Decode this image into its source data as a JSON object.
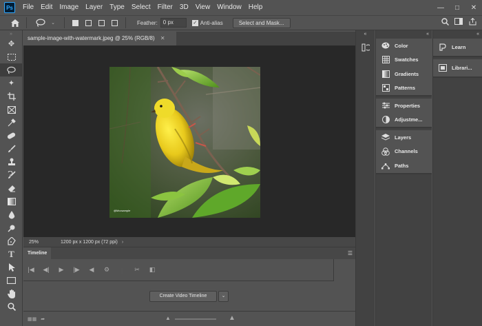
{
  "app": {
    "logo": "Ps",
    "menu": [
      "File",
      "Edit",
      "Image",
      "Layer",
      "Type",
      "Select",
      "Filter",
      "3D",
      "View",
      "Window",
      "Help"
    ],
    "window_controls": [
      "minimize-icon",
      "maximize-icon",
      "close-icon"
    ]
  },
  "options_bar": {
    "feather_label": "Feather:",
    "feather_value": "0 px",
    "anti_alias_label": "Anti-alias",
    "select_mask_label": "Select and Mask...",
    "icons": [
      "home-icon",
      "lasso-icon",
      "new-selection-icon",
      "add-selection-icon",
      "subtract-selection-icon",
      "intersect-selection-icon",
      "search-icon",
      "workspace-icon",
      "share-icon"
    ]
  },
  "tools": [
    "move-icon",
    "marquee-icon",
    "lasso-icon",
    "magic-wand-icon",
    "crop-icon",
    "frame-icon",
    "eyedropper-icon",
    "healing-brush-icon",
    "brush-icon",
    "clone-stamp-icon",
    "history-brush-icon",
    "eraser-icon",
    "gradient-icon",
    "blur-icon",
    "dodge-icon",
    "pen-icon",
    "type-icon",
    "path-selection-icon",
    "rectangle-icon",
    "hand-icon",
    "zoom-icon"
  ],
  "document": {
    "tab_title": "sample-image-with-watermark.jpeg @ 25% (RGB/8)",
    "watermark": "@Mccsample"
  },
  "status": {
    "zoom": "25%",
    "dimensions": "1200 px x 1200 px (72 ppi)",
    "arrow": "›"
  },
  "timeline": {
    "title": "Timeline",
    "create_button": "Create Video Timeline"
  },
  "panels_col1": {
    "group1": [
      {
        "label": "Color",
        "icon": "color-palette-icon"
      },
      {
        "label": "Swatches",
        "icon": "swatches-icon"
      },
      {
        "label": "Gradients",
        "icon": "gradients-icon"
      },
      {
        "label": "Patterns",
        "icon": "patterns-icon"
      }
    ],
    "group2": [
      {
        "label": "Properties",
        "icon": "properties-icon"
      },
      {
        "label": "Adjustme...",
        "icon": "adjustments-icon"
      }
    ],
    "group3": [
      {
        "label": "Layers",
        "icon": "layers-icon"
      },
      {
        "label": "Channels",
        "icon": "channels-icon"
      },
      {
        "label": "Paths",
        "icon": "paths-icon"
      }
    ]
  },
  "panels_col2": [
    {
      "label": "Learn",
      "icon": "learn-icon"
    },
    {
      "label": "Librari...",
      "icon": "libraries-icon"
    }
  ]
}
